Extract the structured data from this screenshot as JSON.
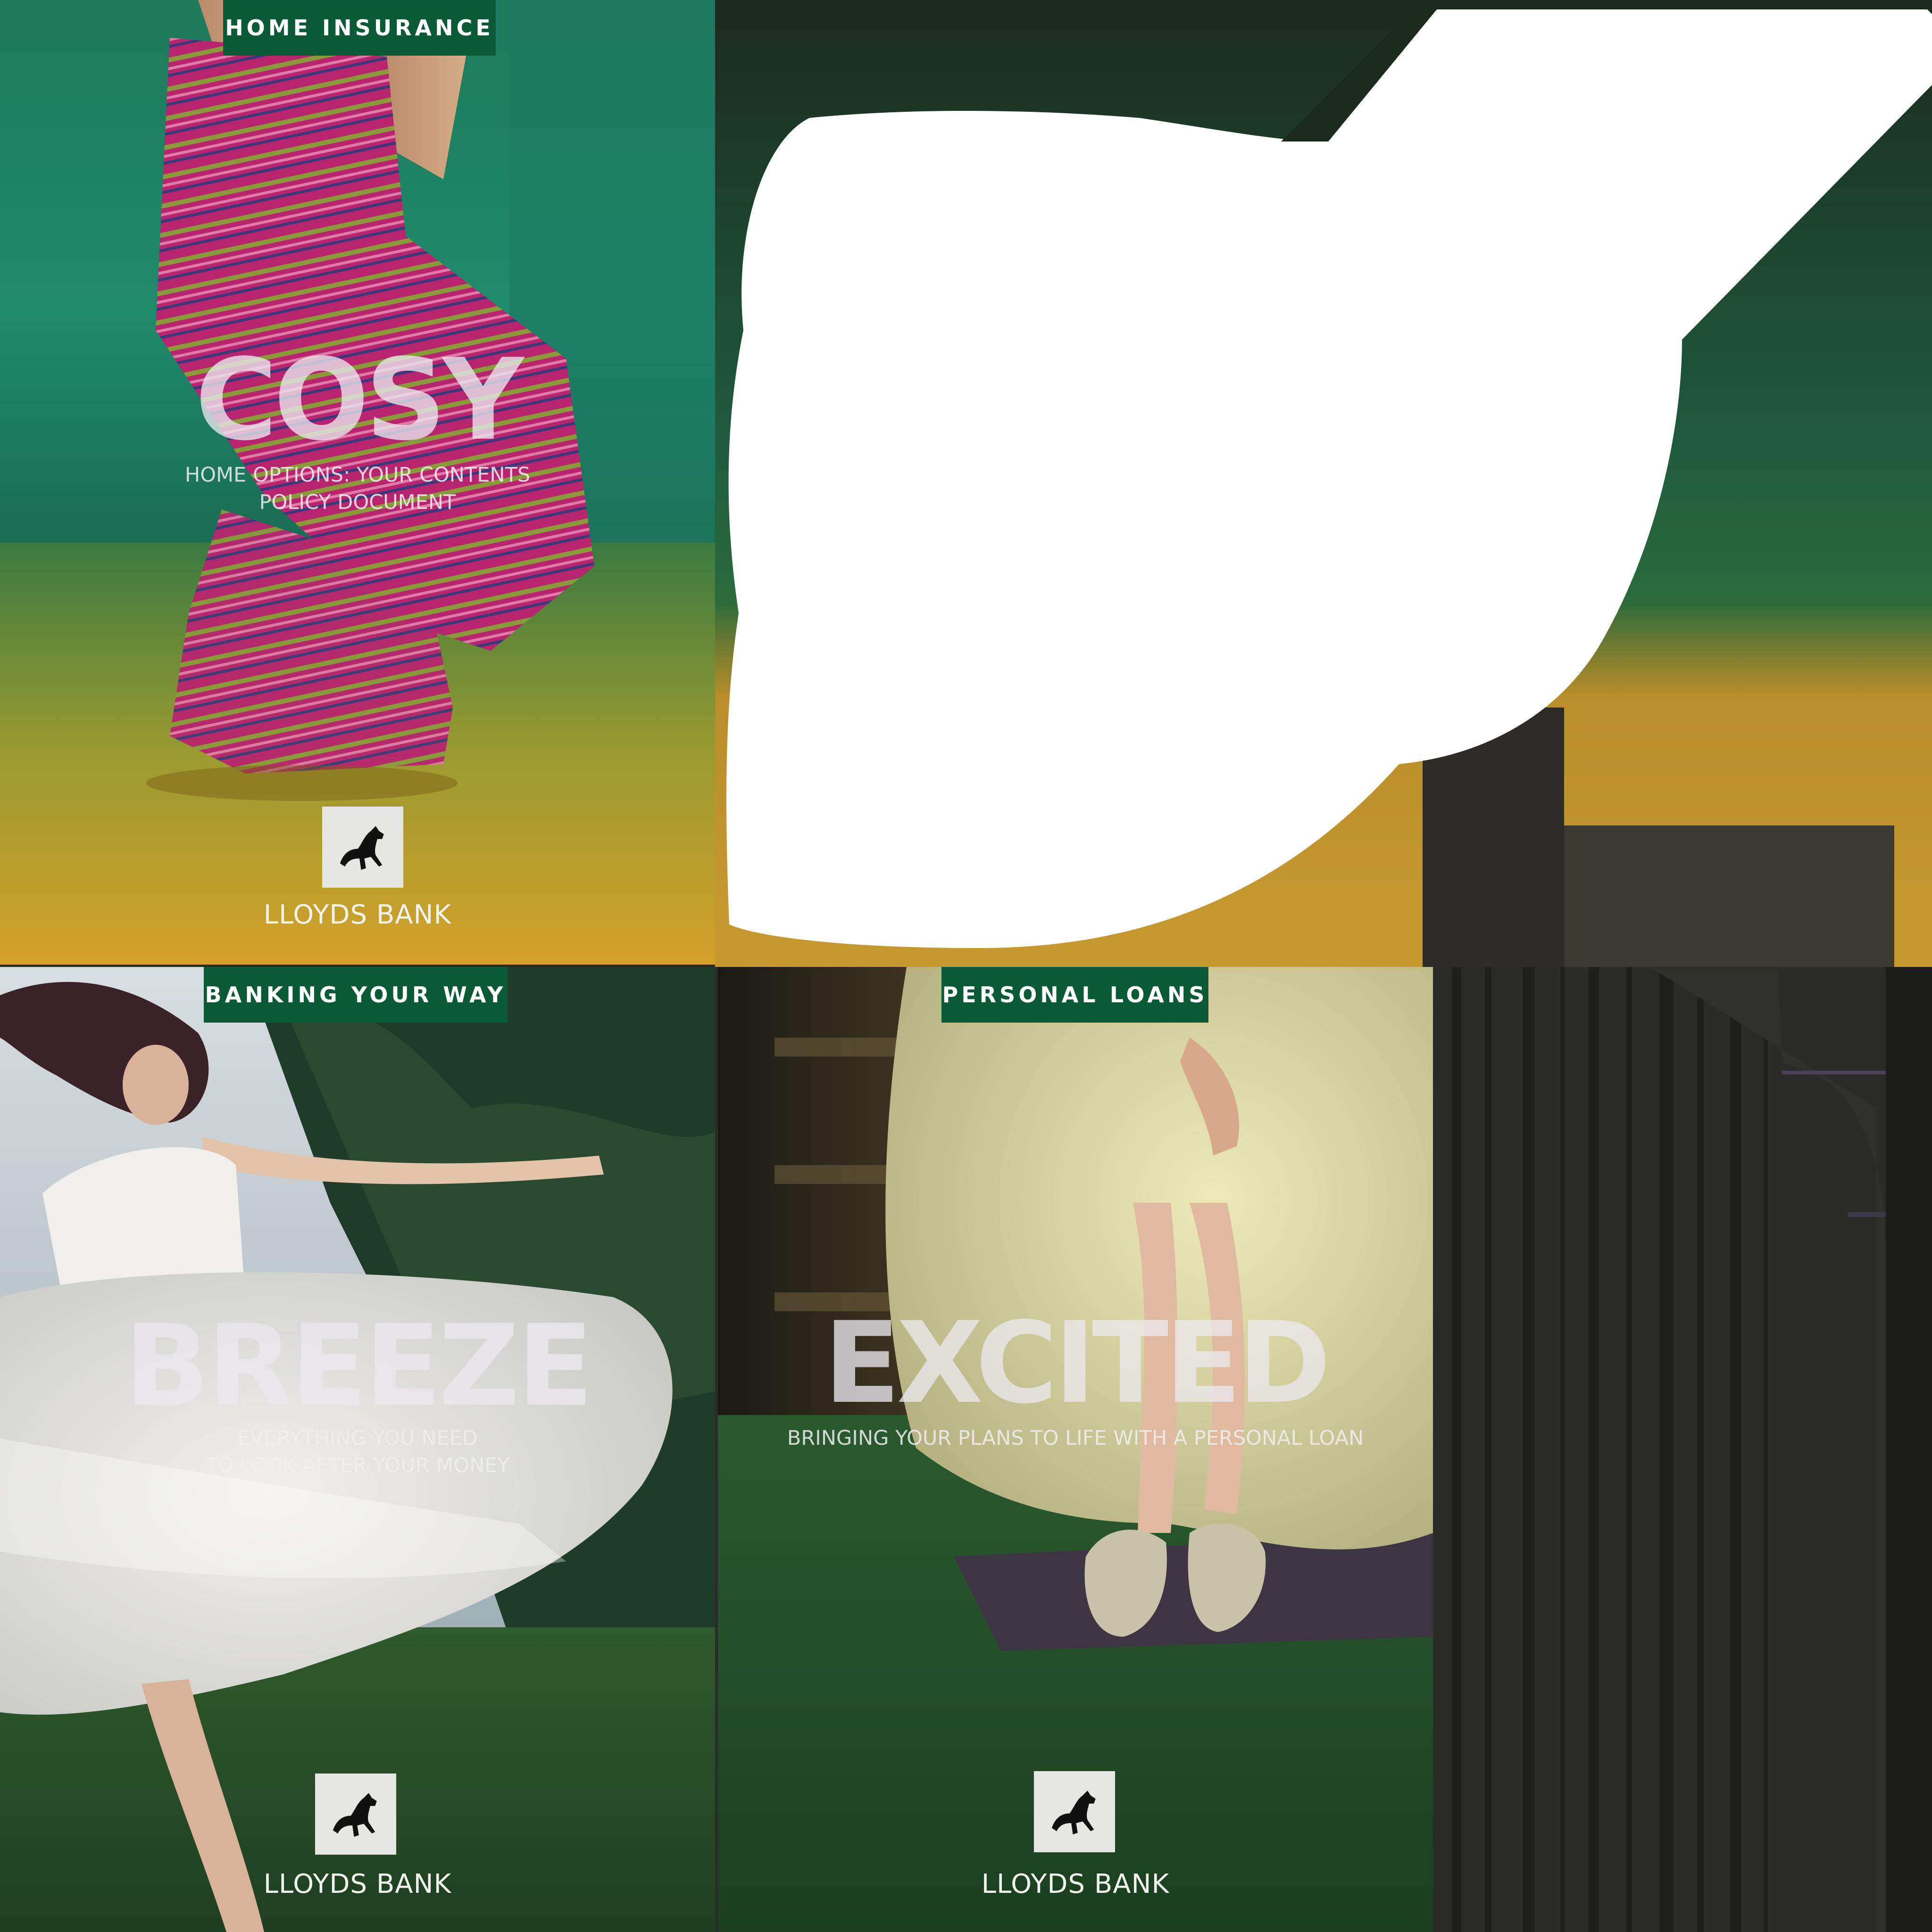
{
  "covers": {
    "cosy": {
      "tag": "HOME INSURANCE",
      "headline": "COSY",
      "subline": "HOME OPTIONS: YOUR CONTENTS\nPOLICY DOCUMENT",
      "brand": "LLOYDS BANK"
    },
    "breeze": {
      "tag": "BANKING YOUR WAY",
      "headline": "BREEZE",
      "subline": "EVERYTHING YOU NEED\nTO LOOK AFTER YOUR MONEY",
      "brand": "LLOYDS BANK"
    },
    "excited": {
      "tag": "PERSONAL LOANS",
      "headline": "EXCITED",
      "subline": "BRINGING YOUR PLANS TO LIFE WITH A PERSONAL LOAN",
      "brand": "LLOYDS BANK"
    }
  },
  "colors": {
    "brand_green": "#0b5a36",
    "logo_box": "#e6e6e2",
    "background": "#2b2b29"
  },
  "icons": [
    "black-horse-logo-icon"
  ]
}
